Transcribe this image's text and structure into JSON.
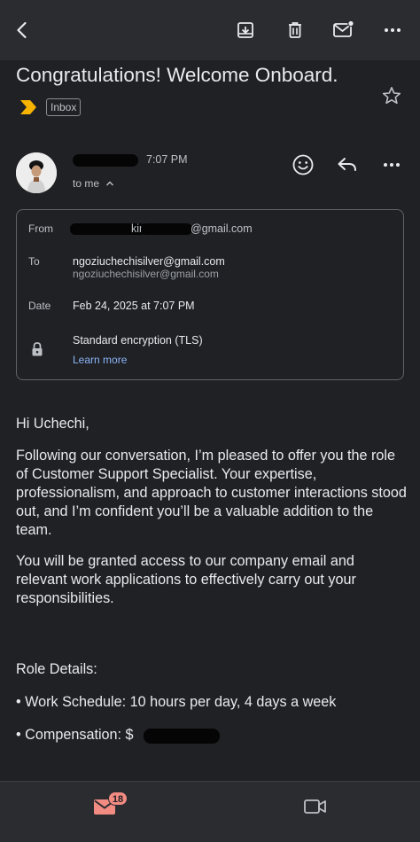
{
  "subject": "Congratulations! Welcome Onboard.",
  "label": "Inbox",
  "header": {
    "time": "7:07 PM",
    "recipient": "to me"
  },
  "details": {
    "from_label": "From",
    "from_partial": "kir",
    "from_domain": "@gmail.com",
    "to_label": "To",
    "to_value": "ngoziuchechisilver@gmail.com",
    "to_sub": "ngoziuchechisilver@gmail.com",
    "date_label": "Date",
    "date_value": "Feb 24, 2025 at 7:07 PM",
    "encryption": "Standard encryption (TLS)",
    "learn_more": "Learn more"
  },
  "body": {
    "greeting": "Hi Uchechi,",
    "p1": "Following our conversation, I’m pleased to offer you the role of Customer Support Specialist. Your expertise, professionalism, and approach to customer interactions stood out, and I’m confident you’ll be a valuable addition to the team.",
    "p2": "You will be granted access to our company email and relevant work applications to effectively carry out your responsibilities.",
    "role_heading": "Role Details:",
    "bullet1": "• Work Schedule: 10 hours per day, 4 days a week",
    "bullet2": "• Compensation: $"
  },
  "bottom": {
    "mail_badge": "18"
  },
  "icons": {
    "back": "back-arrow-icon",
    "archive": "archive-icon",
    "delete": "trash-icon",
    "unread": "mark-unread-icon",
    "more": "more-vert-icon",
    "important": "important-marker-icon",
    "star": "star-icon",
    "emoji": "emoji-icon",
    "reply": "reply-icon",
    "lock": "lock-icon",
    "mail": "mail-icon",
    "video": "video-icon"
  },
  "colors": {
    "background": "#202124",
    "bar": "#2b2c2f",
    "link": "#8ab4f8",
    "important": "#f6b400",
    "badge": "#f28b82"
  }
}
